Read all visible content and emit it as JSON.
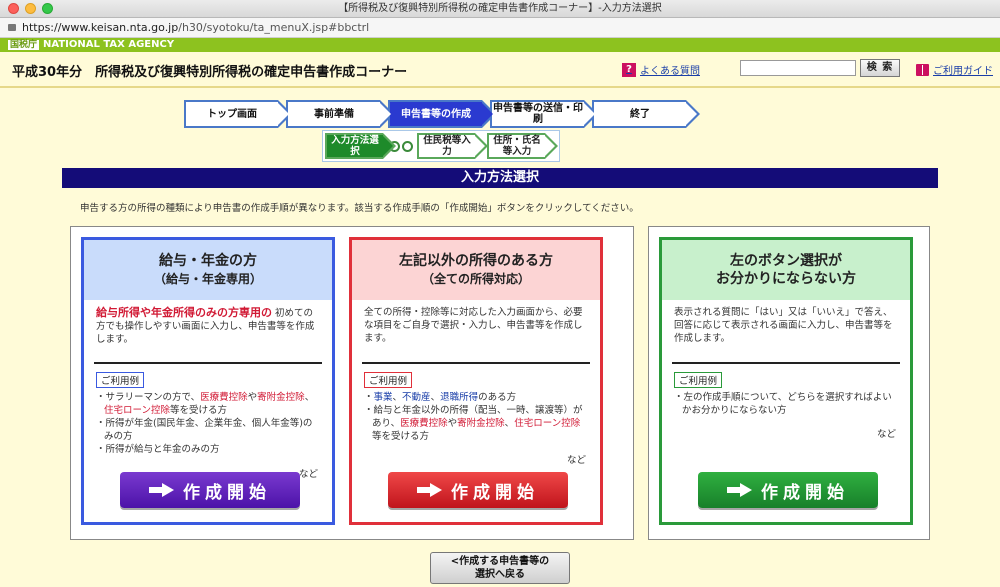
{
  "window": {
    "title": "【所得税及び復興特別所得税の確定申告書作成コーナー】-入力方法選択",
    "url_host": "https://www.keisan.nta.go.jp",
    "url_path": "/h30/syotoku/ta_menuX.jsp#bbctrl"
  },
  "agency": {
    "kanji": "国税庁",
    "name": "NATIONAL TAX AGENCY"
  },
  "header": {
    "title": "平成30年分　所得税及び復興特別所得税の確定申告書作成コーナー",
    "faq_label": "よくある質問",
    "search_value": "",
    "search_button": "検 索",
    "guide_label": "ご利用ガイド"
  },
  "steps": [
    {
      "label": "トップ画面"
    },
    {
      "label": "事前準備"
    },
    {
      "label": "申告書等の作成"
    },
    {
      "label": "申告書等の送信・印刷"
    },
    {
      "label": "終了"
    }
  ],
  "substeps": [
    {
      "label": "入力方法選択"
    },
    {
      "label": "住民税等入力"
    },
    {
      "label": "住所・氏名等入力"
    }
  ],
  "section_title": "入力方法選択",
  "intro": "申告する方の所得の種類により申告書の作成手順が異なります。該当する作成手順の「作成開始」ボタンをクリックしてください。",
  "cards": {
    "salary": {
      "title": "給与・年金の方",
      "subtitle": "（給与・年金専用）",
      "lead": "給与所得や年金所得のみの方専用の",
      "desc": "初めての方でも操作しやすい画面に入力し、申告書等を作成します。",
      "use_label": "ご利用例",
      "item1_a": "サラリーマンの方で、",
      "item1_b": "医療費控除",
      "item1_c": "や",
      "item1_d": "寄附金控除",
      "item1_e": "、",
      "item1_f": "住宅ローン控除",
      "item1_g": "等を受ける方",
      "item2": "所得が年金(国民年金、企業年金、個人年金等)のみの方",
      "item3": "所得が給与と年金のみの方",
      "etc": "など",
      "button": "作成開始"
    },
    "other": {
      "title": "左記以外の所得のある方",
      "subtitle": "（全ての所得対応）",
      "desc": "全ての所得・控除等に対応した入力画面から、必要な項目をご自身で選択・入力し、申告書等を作成します。",
      "use_label": "ご利用例",
      "item1_a": "事業",
      "item1_b": "、",
      "item1_c": "不動産",
      "item1_d": "、",
      "item1_e": "退職所得",
      "item1_f": "のある方",
      "item2_a": "給与と年金以外の所得（配当、一時、譲渡等）があり、",
      "item2_b": "医療費控除",
      "item2_c": "や",
      "item2_d": "寄附金控除",
      "item2_e": "、",
      "item2_f": "住宅ローン控除",
      "item2_g": "等を受ける方",
      "etc": "など",
      "button": "作成開始"
    },
    "unsure": {
      "title": "左のボタン選択が",
      "title2": "お分かりにならない方",
      "desc": "表示される質問に「はい」又は「いいえ」で答え、回答に応じて表示される画面に入力し、申告書等を作成します。",
      "use_label": "ご利用例",
      "item1": "左の作成手順について、どちらを選択すればよいかお分かりにならない方",
      "etc": "など",
      "button": "作成開始"
    }
  },
  "back_button_line1": "<作成する申告書等の",
  "back_button_line2": "選択へ戻る"
}
